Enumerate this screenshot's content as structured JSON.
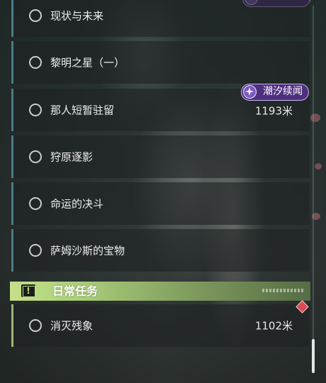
{
  "colors": {
    "quest_accent": "#4d7a86",
    "daily_accent": "#9fb47a",
    "badge_bg": "#4d2f7e",
    "category_header": "#c4e088",
    "tracking_marker": "#d94a52"
  },
  "quest_list": [
    {
      "title": "现状与未来",
      "status_icon": "circle-outline-icon"
    },
    {
      "title": "黎明之星（一）",
      "status_icon": "circle-outline-icon"
    },
    {
      "title": "那人短暂驻留",
      "distance": "1193米",
      "badge": "潮汐续闻",
      "status_icon": "circle-outline-icon"
    },
    {
      "title": "狩原逐影",
      "status_icon": "circle-outline-icon"
    },
    {
      "title": "命运的决斗",
      "status_icon": "circle-outline-icon"
    },
    {
      "title": "萨姆沙斯的宝物",
      "status_icon": "circle-outline-icon"
    }
  ],
  "daily_section": {
    "header_title": "日常任务",
    "header_icon": "exclamation-box-icon",
    "items": [
      {
        "title": "消灭残象",
        "distance": "1102米",
        "status_icon": "circle-outline-icon",
        "marker_icon": "diamond-marker-icon"
      }
    ]
  }
}
